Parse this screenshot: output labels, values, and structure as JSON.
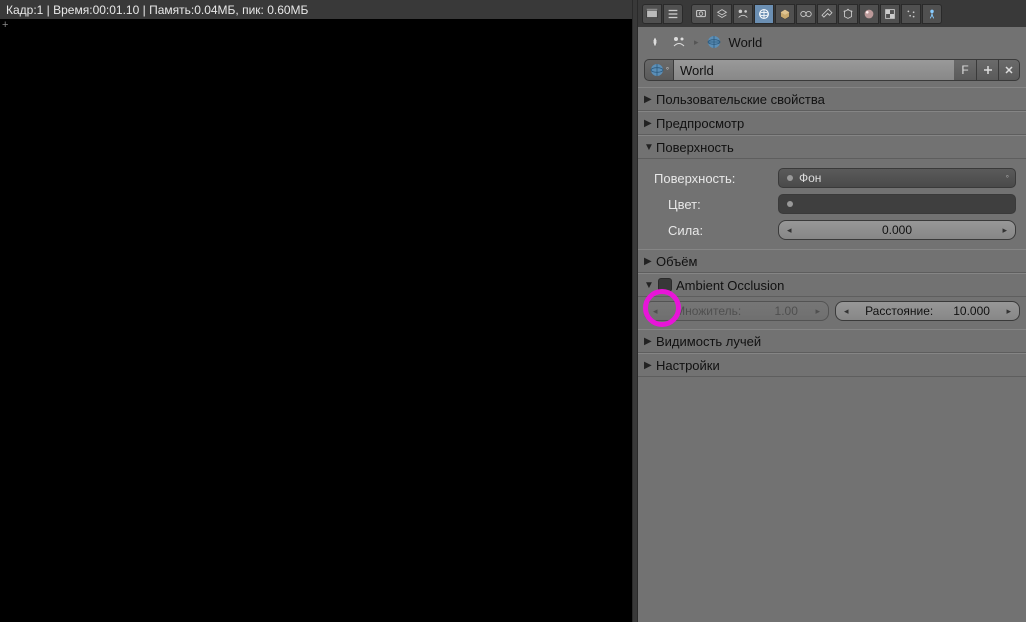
{
  "status": "Кадр:1 | Время:00:01.10 | Память:0.04МБ, пик: 0.60МБ",
  "breadcrumb": {
    "label": "World"
  },
  "datablock": {
    "name": "World",
    "fake": "F"
  },
  "panels": {
    "custom_props": "Пользовательские свойства",
    "preview": "Предпросмотр",
    "surface": {
      "title": "Поверхность",
      "surface_label": "Поверхность:",
      "surface_value": "Фон",
      "color_label": "Цвет:",
      "strength_label": "Сила:",
      "strength_value": "0.000"
    },
    "volume": "Объём",
    "ao": {
      "title": "Ambient Occlusion",
      "factor_label": "Множитель:",
      "factor_value": "1.00",
      "distance_label": "Расстояние:",
      "distance_value": "10.000"
    },
    "ray_vis": "Видимость лучей",
    "settings": "Настройки"
  }
}
